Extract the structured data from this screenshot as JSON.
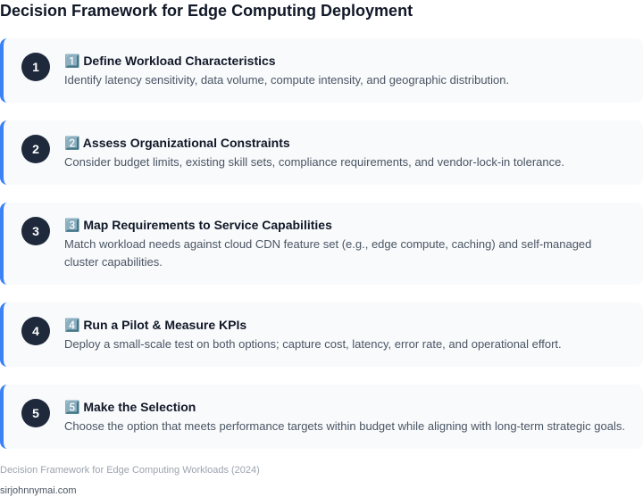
{
  "title": "Decision Framework for Edge Computing Deployment",
  "steps": [
    {
      "number": "1",
      "heading": "1️⃣ Define Workload Characteristics",
      "description": "Identify latency sensitivity, data volume, compute intensity, and geographic distribution."
    },
    {
      "number": "2",
      "heading": "2️⃣ Assess Organizational Constraints",
      "description": "Consider budget limits, existing skill sets, compliance requirements, and vendor-lock-in tolerance."
    },
    {
      "number": "3",
      "heading": "3️⃣ Map Requirements to Service Capabilities",
      "description": "Match workload needs against cloud CDN feature set (e.g., edge compute, caching) and self-managed cluster capabilities."
    },
    {
      "number": "4",
      "heading": "4️⃣ Run a Pilot & Measure KPIs",
      "description": "Deploy a small-scale test on both options; capture cost, latency, error rate, and operational effort."
    },
    {
      "number": "5",
      "heading": "5️⃣ Make the Selection",
      "description": "Choose the option that meets performance targets within budget while aligning with long-term strategic goals."
    }
  ],
  "caption": "Decision Framework for Edge Computing Workloads (2024)",
  "credit": "sirjohnnymai.com",
  "colors": {
    "accent": "#3b82f6",
    "badge": "#1e293b",
    "card_background": "#f8fafc"
  }
}
